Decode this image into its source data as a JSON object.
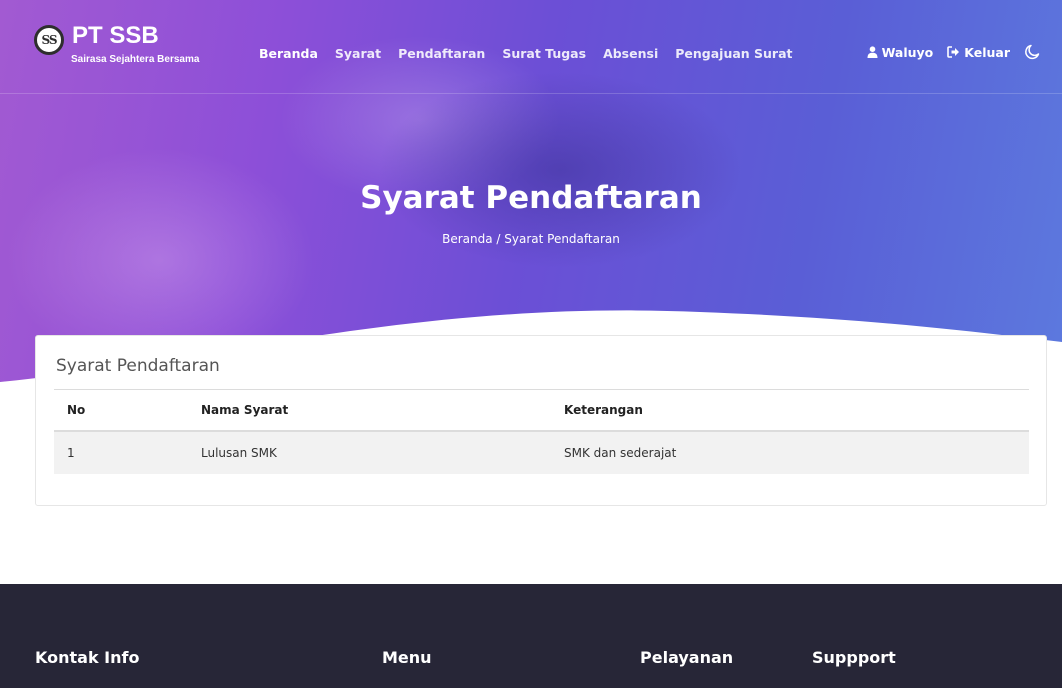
{
  "brand": {
    "logo_text": "SS",
    "title": "PT SSB",
    "subtitle": "Sairasa Sejahtera Bersama"
  },
  "nav": {
    "links": [
      {
        "label": "Beranda",
        "active": true
      },
      {
        "label": "Syarat"
      },
      {
        "label": "Pendaftaran"
      },
      {
        "label": "Surat Tugas"
      },
      {
        "label": "Absensi"
      },
      {
        "label": "Pengajuan Surat"
      }
    ],
    "user_label": "Waluyo",
    "logout_label": "Keluar",
    "theme_toggle_icon": "moon-icon"
  },
  "hero": {
    "title": "Syarat Pendaftaran",
    "breadcrumb": "Beranda / Syarat Pendaftaran"
  },
  "card": {
    "title": "Syarat Pendaftaran",
    "columns": [
      "No",
      "Nama Syarat",
      "Keterangan"
    ],
    "rows": [
      [
        "1",
        "Lulusan SMK",
        "SMK dan sederajat"
      ]
    ]
  },
  "footer": {
    "headings": [
      "Kontak Info",
      "Menu",
      "Pelayanan",
      "Suppport"
    ]
  },
  "colors": {
    "hero_gradient_start": "#a25ad2",
    "hero_gradient_end": "#5c79de",
    "footer_bg": "#272637",
    "row_bg": "#f2f2f2"
  }
}
